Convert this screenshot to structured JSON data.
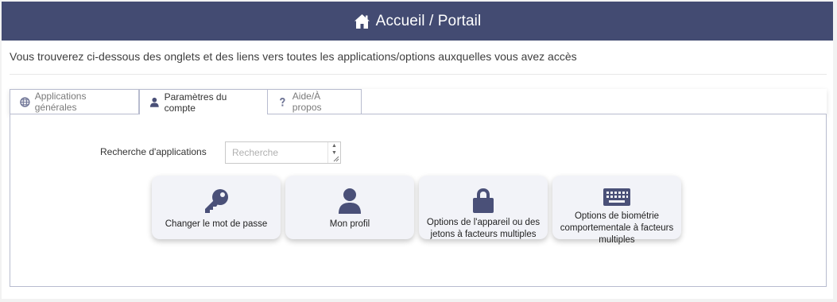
{
  "header": {
    "title": "Accueil / Portail",
    "icon": "home-icon"
  },
  "intro": "Vous trouverez ci-dessous des onglets et des liens vers toutes les applications/options auxquelles vous avez accès",
  "tabs": [
    {
      "label": "Applications générales",
      "icon": "globe-icon",
      "active": false
    },
    {
      "label": "Paramètres du compte",
      "icon": "user-icon",
      "active": true
    },
    {
      "label": "Aide/À propos",
      "icon": "question-icon",
      "active": false
    }
  ],
  "search": {
    "label": "Recherche d'applications",
    "placeholder": "Recherche"
  },
  "cards": [
    {
      "label": "Changer le mot de passe",
      "icon": "key-icon"
    },
    {
      "label": "Mon profil",
      "icon": "user-icon"
    },
    {
      "label": "Options de l'appareil ou des jetons à facteurs multiples",
      "icon": "lock-icon"
    },
    {
      "label": "Options de biométrie comportementale à facteurs multiples",
      "icon": "keyboard-icon"
    }
  ],
  "colors": {
    "header_bg": "#434b72",
    "icon": "#4a5078",
    "card_bg": "#f2f3f8"
  }
}
